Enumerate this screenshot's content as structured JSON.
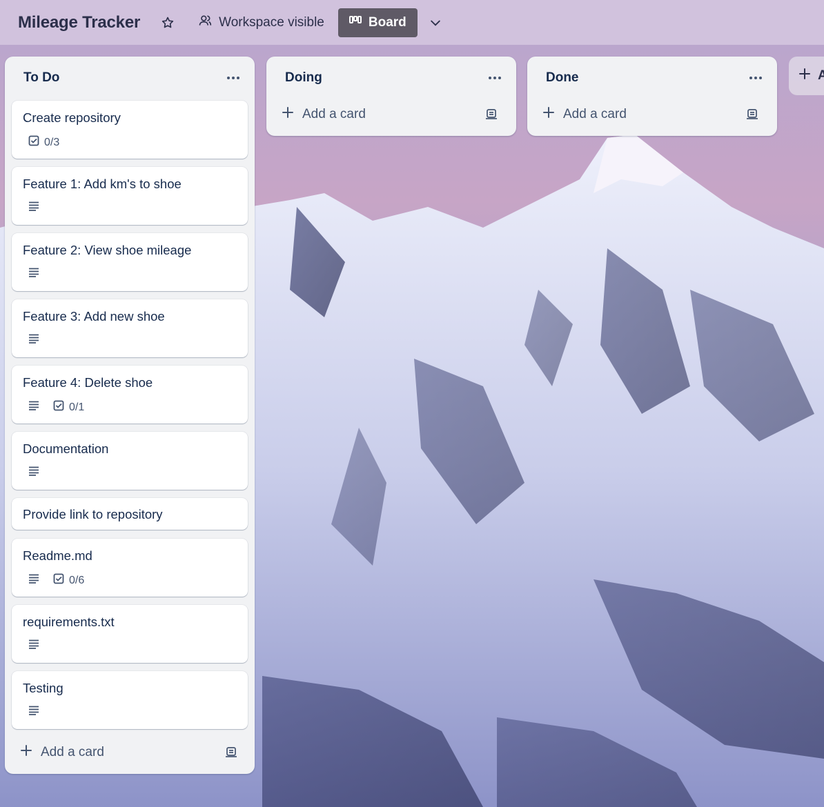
{
  "header": {
    "board_title": "Mileage Tracker",
    "visibility_label": "Workspace visible",
    "view_label": "Board"
  },
  "lists": [
    {
      "title": "To Do",
      "cards": [
        {
          "title": "Create repository",
          "has_description": false,
          "checklist": "0/3"
        },
        {
          "title": "Feature 1: Add km's to shoe",
          "has_description": true,
          "checklist": null
        },
        {
          "title": "Feature 2: View shoe mileage",
          "has_description": true,
          "checklist": null
        },
        {
          "title": "Feature 3: Add new shoe",
          "has_description": true,
          "checklist": null
        },
        {
          "title": "Feature 4: Delete shoe",
          "has_description": true,
          "checklist": "0/1"
        },
        {
          "title": "Documentation",
          "has_description": true,
          "checklist": null
        },
        {
          "title": "Provide link to repository",
          "has_description": false,
          "checklist": null
        },
        {
          "title": "Readme.md",
          "has_description": true,
          "checklist": "0/6"
        },
        {
          "title": "requirements.txt",
          "has_description": true,
          "checklist": null
        },
        {
          "title": "Testing",
          "has_description": true,
          "checklist": null
        }
      ],
      "add_card_label": "Add a card"
    },
    {
      "title": "Doing",
      "cards": [],
      "add_card_label": "Add a card"
    },
    {
      "title": "Done",
      "cards": [],
      "add_card_label": "Add a card"
    }
  ],
  "add_list_label": "A",
  "icons": {
    "star": "star-icon",
    "visibility": "people-icon",
    "board": "board-icon",
    "chevron": "chevron-down-icon",
    "list_menu": "more-horizontal-icon",
    "add": "plus-icon",
    "template": "card-template-icon",
    "description": "description-icon",
    "checklist": "checklist-icon"
  },
  "colors": {
    "header_bg": "#d2c4de",
    "view_switch_bg": "#5f5a66",
    "list_bg": "#f1f2f4",
    "card_bg": "#ffffff",
    "text": "#172b4d"
  }
}
